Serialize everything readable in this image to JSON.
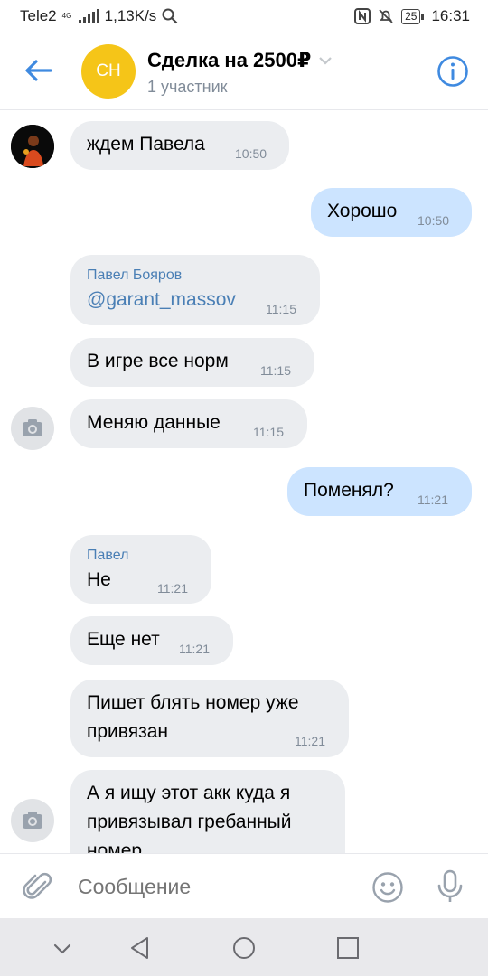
{
  "status_bar": {
    "carrier": "Tele2",
    "net_type": "4G",
    "speed": "1,13K/s",
    "battery": "25",
    "time": "16:31"
  },
  "header": {
    "avatar_initials": "СН",
    "title": "Сделка на 2500₽",
    "subtitle": "1 участник",
    "avatar_color": "#f5c518",
    "accent_color": "#3f8ae0"
  },
  "messages": [
    {
      "dir": "in",
      "text": "ждем Павела",
      "time": "10:50"
    },
    {
      "dir": "out",
      "text": "Хорошо",
      "time": "10:50"
    },
    {
      "dir": "in",
      "sender": "Павел Бояров",
      "text": "@garant_massov",
      "time": "11:15"
    },
    {
      "dir": "in",
      "text": "В игре все норм",
      "time": "11:15"
    },
    {
      "dir": "in",
      "text": "Меняю данные",
      "time": "11:15"
    },
    {
      "dir": "out",
      "text": "Поменял?",
      "time": "11:21"
    },
    {
      "dir": "in",
      "sender": "Павел",
      "text": "Не",
      "time": "11:21"
    },
    {
      "dir": "in",
      "text": "Еще нет",
      "time": "11:21"
    },
    {
      "dir": "in",
      "line1": "Пишет блять номер уже",
      "line2": "привязан",
      "time": "11:21"
    },
    {
      "dir": "in",
      "line1": "А я ищу этот акк куда я",
      "line2": "привязывал гребанный",
      "line3": "номер"
    }
  ],
  "composer": {
    "placeholder": "Сообщение"
  },
  "colors": {
    "incoming_bubble": "#ebedf0",
    "outgoing_bubble": "#cce4ff",
    "sender_name": "#4a7fb5",
    "time": "#818c99"
  }
}
